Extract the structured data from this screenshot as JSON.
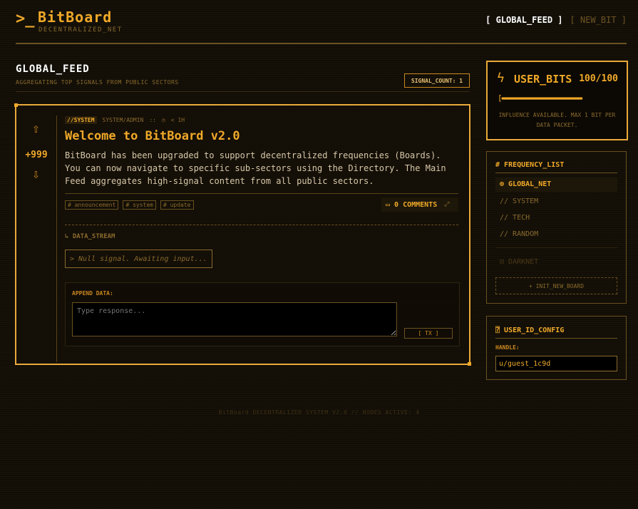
{
  "header": {
    "prompt": ">_",
    "title": "BitBoard",
    "subtitle": "DECENTRALIZED_NET",
    "nav_global": "[ GLOBAL_FEED ]",
    "nav_new": "[ NEW_BIT ]"
  },
  "feed": {
    "title": "GLOBAL_FEED",
    "subtitle": "AGGREGATING TOP SIGNALS FROM PUBLIC SECTORS",
    "signal_count": "SIGNAL_COUNT: 1"
  },
  "post": {
    "score": "+999",
    "tag": "//SYSTEM",
    "author": "SYSTEM/ADMIN",
    "sep": "::",
    "time": "< 1H",
    "title": "Welcome to BitBoard v2.0",
    "body": "BitBoard has been upgraded to support decentralized frequencies (Boards). You can now navigate to specific sub-sectors using the Directory. The Main Feed aggregates high-signal content from all public sectors.",
    "tags": [
      "# announcement",
      "# system",
      "# update"
    ],
    "comments": "0 COMMENTS",
    "stream_label": "DATA_STREAM",
    "null_signal": "> Null signal. Awaiting input...",
    "append_label": "APPEND DATA:",
    "append_placeholder": "Type response...",
    "tx_label": "[ TX ]"
  },
  "bits": {
    "title": "USER_BITS",
    "count": "100/100",
    "bar": "[▬▬▬▬▬▬▬▬▬▬▬▬▬▬▬▬▬▬▬▬",
    "level": 1.0,
    "note": "INFLUENCE AVAILABLE. MAX 1 BIT PER DATA PACKET."
  },
  "frequency": {
    "title": "FREQUENCY_LIST",
    "items": [
      "GLOBAL_NET",
      "// SYSTEM",
      "// TECH",
      "// RANDOM"
    ],
    "darknet": "DARKNET",
    "init": "+ INIT_NEW_BOARD"
  },
  "userid": {
    "title": "USER_ID_CONFIG",
    "handle_label": "HANDLE:",
    "handle_value": "u/guest_1c9d"
  },
  "footer": "BitBoard DECENTRALIZED SYSTEM V2.0 // NODES ACTIVE: 4",
  "colors": {
    "accent": "#f0a929",
    "background": "#120e06"
  }
}
